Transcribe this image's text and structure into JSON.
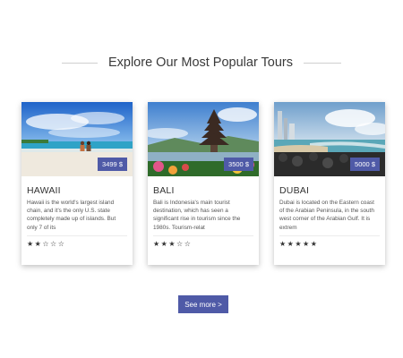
{
  "section": {
    "title": "Explore Our Most Popular Tours"
  },
  "tours": [
    {
      "name": "HAWAII",
      "price": "3499 $",
      "description": "Hawaii is the world's largest island chain, and it's the only U.S. state completely made up of islands. But only 7 of its",
      "stars": "★★☆☆☆",
      "rating": 2
    },
    {
      "name": "BALI",
      "price": "3500 $",
      "description": "Bali is Indonesia's main tourist destination, which has seen a significant rise in tourism since the 1980s. Tourism-relat",
      "stars": "★★★☆☆",
      "rating": 3
    },
    {
      "name": "DUBAI",
      "price": "5000 $",
      "description": "Dubai is located on the Eastern coast of the Arabian Peninsula, in the south west corner of the Arabian Gulf. It is extrem",
      "stars": "★★★★★",
      "rating": 5
    }
  ],
  "actions": {
    "see_more_label": "See more >"
  },
  "colors": {
    "accent": "#4f5aa7"
  }
}
